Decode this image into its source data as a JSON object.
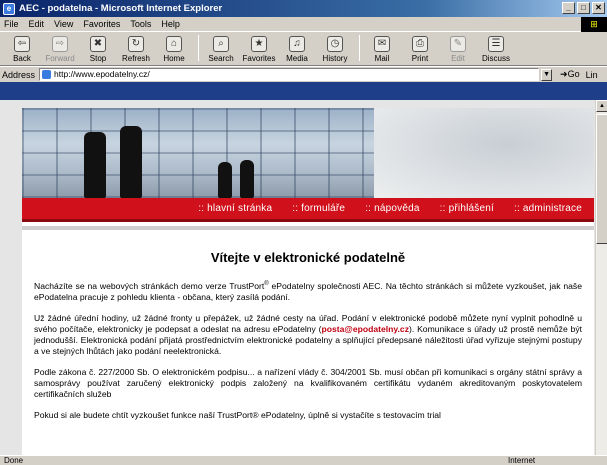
{
  "window": {
    "title": "AEC - podatelna - Microsoft Internet Explorer"
  },
  "menu": [
    "File",
    "Edit",
    "View",
    "Favorites",
    "Tools",
    "Help"
  ],
  "toolbar": [
    {
      "label": "Back",
      "icon": "back-arrow-icon",
      "glyph": "⇦",
      "enabled": true
    },
    {
      "label": "Forward",
      "icon": "forward-arrow-icon",
      "glyph": "⇨",
      "enabled": false
    },
    {
      "label": "Stop",
      "icon": "stop-icon",
      "glyph": "✖",
      "enabled": true
    },
    {
      "label": "Refresh",
      "icon": "refresh-icon",
      "glyph": "↻",
      "enabled": true
    },
    {
      "label": "Home",
      "icon": "home-icon",
      "glyph": "⌂",
      "enabled": true
    },
    {
      "label": "Search",
      "icon": "search-icon",
      "glyph": "⌕",
      "enabled": true
    },
    {
      "label": "Favorites",
      "icon": "favorites-icon",
      "glyph": "★",
      "enabled": true
    },
    {
      "label": "Media",
      "icon": "media-icon",
      "glyph": "♫",
      "enabled": true
    },
    {
      "label": "History",
      "icon": "history-icon",
      "glyph": "◷",
      "enabled": true
    },
    {
      "label": "Mail",
      "icon": "mail-icon",
      "glyph": "✉",
      "enabled": true
    },
    {
      "label": "Print",
      "icon": "print-icon",
      "glyph": "⎙",
      "enabled": true
    },
    {
      "label": "Edit",
      "icon": "edit-icon",
      "glyph": "✎",
      "enabled": false
    },
    {
      "label": "Discuss",
      "icon": "discuss-icon",
      "glyph": "☰",
      "enabled": true
    }
  ],
  "address": {
    "label": "Address",
    "url": "http://www.epodatelny.cz/",
    "go": "Go",
    "links": "Lin"
  },
  "nav": [
    ":: hlavní stránka",
    ":: formuláře",
    ":: nápověda",
    ":: přihlášení",
    ":: administrace"
  ],
  "content": {
    "heading": "Vítejte v elektronické podatelně",
    "p1_a": "Nacházíte se na webových stránkách demo verze TrustPort",
    "p1_sup": "®",
    "p1_b": " ePodatelny společnosti AEC. Na těchto stránkách si můžete vyzkoušet, jak naše ePodatelna pracuje z pohledu klienta - občana, který zasílá podání.",
    "p2_a": "Už žádné úřední hodiny, už žádné fronty u přepážek, už žádné cesty na úřad. Podání v elektronické podobě můžete nyní vyplnit pohodlně u svého počítače, elektronicky je podepsat a odeslat na adresu ePodatelny (",
    "p2_email": "posta@epodatelny.cz",
    "p2_b": "). Komunikace s úřady už prostě nemůže být jednodušší. Elektronická podání přijatá prostřednictvím elektronické podatelny a splňující předepsané náležitosti úřad vyřizuje stejnými postupy a ve stejných lhůtách jako podání neelektronická.",
    "p3": "Podle zákona č. 227/2000 Sb. O elektronickém podpisu... a nařízení vlády č. 304/2001 Sb. musí občan při komunikaci s orgány státní správy a samosprávy používat zaručený elektronický podpis založený na kvalifikovaném certifikátu vydaném akreditovaným poskytovatelem certifikačních služeb",
    "p4": "Pokud si ale budete chtít vyzkoušet funkce naší TrustPort® ePodatelny, úplně si vystačíte s testovacím trial"
  },
  "status": {
    "left": "Done",
    "right": "Internet"
  }
}
